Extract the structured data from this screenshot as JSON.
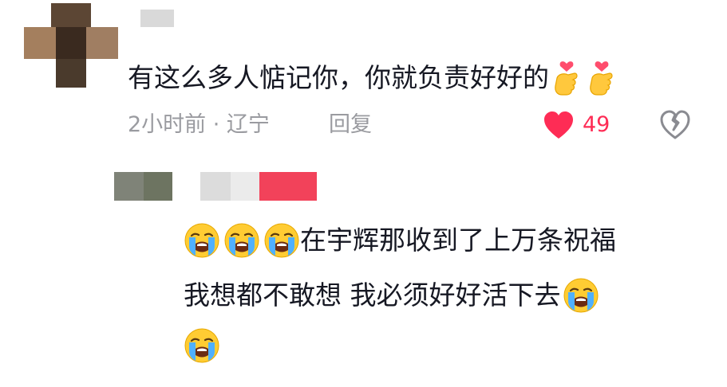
{
  "comment": {
    "text": "有这么多人惦记你，你就负责好好的",
    "trailing_emoji": [
      "finger-heart-emoji",
      "finger-heart-emoji"
    ],
    "meta": "2小时前 · 辽宁",
    "reply_label": "回复",
    "like_count": "49",
    "like_color": "#fe2c55"
  },
  "reply": {
    "line1_text": "在宇辉那收到了上万条祝福",
    "line2_text": "我想都不敢想 我必须好好活下去",
    "line1_leading_emoji": [
      "loudly-crying-emoji",
      "loudly-crying-emoji",
      "loudly-crying-emoji"
    ],
    "line2_trailing_emoji": [
      "loudly-crying-emoji"
    ],
    "line3_emoji": [
      "loudly-crying-emoji"
    ]
  },
  "colors": {
    "meta_gray": "#9a9ba0",
    "text": "#161823"
  }
}
